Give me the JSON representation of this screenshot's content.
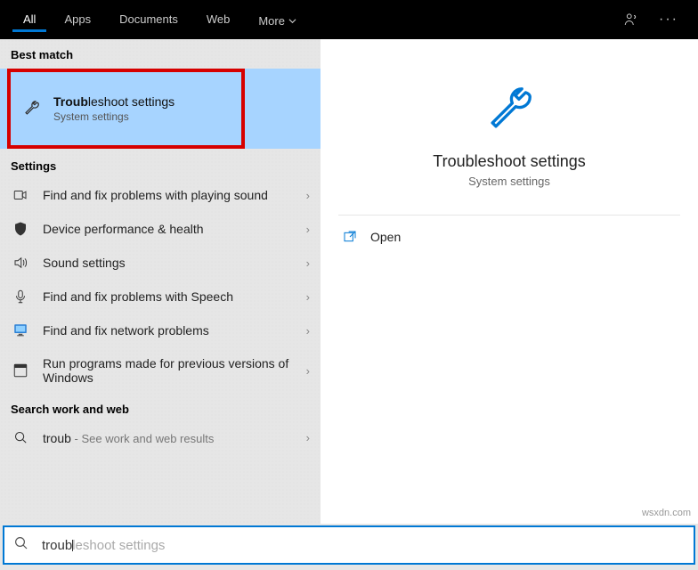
{
  "header": {
    "tabs": [
      "All",
      "Apps",
      "Documents",
      "Web",
      "More"
    ]
  },
  "bestMatch": {
    "header": "Best match",
    "title": "leshoot settings",
    "titleBold": "Troub",
    "subtitle": "System settings"
  },
  "settingsHeader": "Settings",
  "settings": [
    {
      "label": "Find and fix problems with playing sound"
    },
    {
      "label": "Device performance & health"
    },
    {
      "label": "Sound settings"
    },
    {
      "label": "Find and fix problems with Speech"
    },
    {
      "label": "Find and fix network problems"
    },
    {
      "label": "Run programs made for previous versions of Windows"
    }
  ],
  "searchWork": {
    "header": "Search work and web",
    "query": "troub",
    "hint": " - See work and web results"
  },
  "detail": {
    "title": "Troubleshoot settings",
    "subtitle": "System settings",
    "action": "Open"
  },
  "searchBar": {
    "typed": "troub",
    "placeholder": "leshoot settings"
  },
  "watermark": "wsxdn.com"
}
